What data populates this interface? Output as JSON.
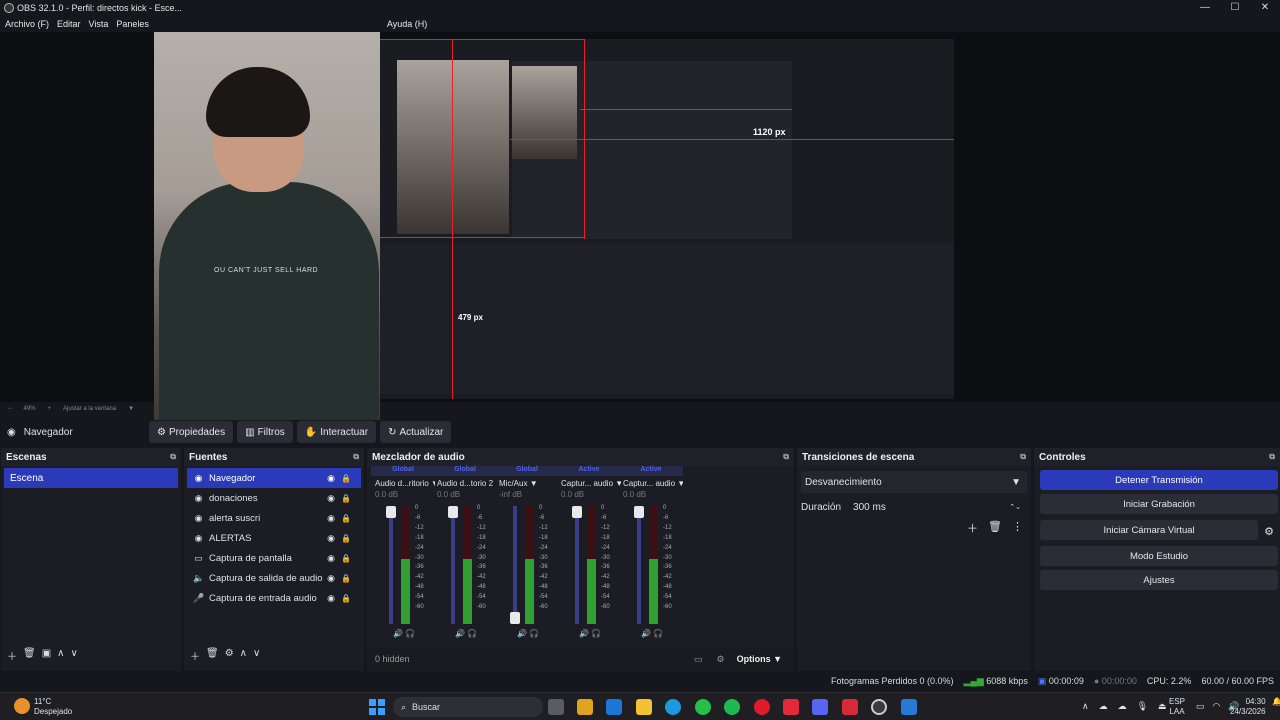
{
  "window": {
    "title": "OBS 32.1.0 - Perfil: directos kick - Esce..."
  },
  "menu": [
    "Archivo (F)",
    "Editar",
    "Vista",
    "Paneles",
    "Ayuda (H)"
  ],
  "preview": {
    "annotation_width": "1120 px",
    "annotation_height": "479 px"
  },
  "zoom": {
    "level": "49%",
    "fit_label": "Ajustar a la ventana"
  },
  "toolbar": {
    "source_name": "Navegador",
    "buttons": [
      "Propiedades",
      "Filtros",
      "Interactuar",
      "Actualizar"
    ]
  },
  "scenes": {
    "title": "Escenas",
    "items": [
      "Escena"
    ],
    "selected": 0
  },
  "sources": {
    "title": "Fuentes",
    "items": [
      {
        "label": "Navegador",
        "icon": "globe-icon"
      },
      {
        "label": "donaciones",
        "icon": "globe-icon"
      },
      {
        "label": "alerta suscri",
        "icon": "globe-icon"
      },
      {
        "label": "ALERTAS",
        "icon": "globe-icon"
      },
      {
        "label": "Captura de pantalla",
        "icon": "monitor-icon"
      },
      {
        "label": "Captura de salida de audio",
        "icon": "speaker-icon"
      },
      {
        "label": "Captura de entrada audio",
        "icon": "mic-icon"
      }
    ]
  },
  "mixer": {
    "title": "Mezclador de audio",
    "channels": [
      {
        "tag": "Global",
        "name": "Audio d...ritorio",
        "db": "0.0 dB",
        "level": 0.55,
        "fader": 1.0
      },
      {
        "tag": "Global",
        "name": "Audio d...torio 2",
        "db": "0.0 dB",
        "level": 0.55,
        "fader": 1.0
      },
      {
        "tag": "Global",
        "name": "Mic/Aux",
        "db": "-inf dB",
        "level": 0.55,
        "fader": 0.0
      },
      {
        "tag": "Active",
        "name": "Captur... audio",
        "db": "0.0 dB",
        "level": 0.55,
        "fader": 1.0
      },
      {
        "tag": "Active",
        "name": "Captur... audio",
        "db": "0.0 dB",
        "level": 0.55,
        "fader": 1.0
      }
    ],
    "scale": [
      "0",
      "-6",
      "-12",
      "-18",
      "-24",
      "-30",
      "-36",
      "-42",
      "-48",
      "-54",
      "-60"
    ],
    "hidden": "0 hidden",
    "options": "Options"
  },
  "transitions": {
    "title": "Transiciones de escena",
    "selected": "Desvanecimiento",
    "duration_label": "Duración",
    "duration_value": "300 ms"
  },
  "controls": {
    "title": "Controles",
    "buttons": [
      "Detener Transmisión",
      "Iniciar Grabación",
      "Iniciar Cámara Virtual",
      "Modo Estudio",
      "Ajustes"
    ]
  },
  "status": {
    "dropped": "Fotogramas Perdidos 0 (0.0%)",
    "bitrate": "6088 kbps",
    "stream_time": "00:00:09",
    "rec_time": "00:00:00",
    "cpu": "CPU: 2.2%",
    "fps": "60.00 / 60.00 FPS"
  },
  "taskbar": {
    "weather_temp": "11°C",
    "weather_desc": "Despejado",
    "search": "Buscar",
    "lang1": "ESP",
    "lang2": "LAA",
    "time": "04:30",
    "date": "24/3/2026"
  },
  "colors": {
    "accent": "#2a3ab8",
    "background": "#1c1d24",
    "marker": "#e8202a"
  }
}
